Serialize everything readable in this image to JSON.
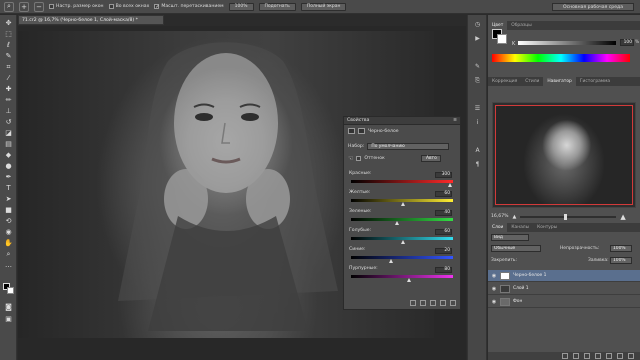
{
  "options_bar": {
    "resize_windows": "Настр. размер окон",
    "all_windows": "Во всех окнах",
    "scrubby_zoom": "Масшт. перетаскиванием",
    "zoom_100": "100%",
    "fit_screen": "Подогнать",
    "fill_screen": "Полный экран",
    "workspace": "Основная рабочая среда"
  },
  "document": {
    "tab_title": "71.cr2 @ 16,7% (Черно-белое 1, Слой-маска/8) *"
  },
  "properties": {
    "title": "Свойства",
    "adjustment_name": "Черно-белое",
    "preset_label": "Набор:",
    "preset_value": "По умолчанию",
    "tint_label": "Оттенок",
    "auto_label": "Авто",
    "sliders": [
      {
        "label": "Красные:",
        "value": "300",
        "percent": 0.99,
        "gradient": "linear-gradient(90deg,#000,#ff2a2a)"
      },
      {
        "label": "Желтые:",
        "value": "60",
        "percent": 0.52,
        "gradient": "linear-gradient(90deg,#000,#ffee33)"
      },
      {
        "label": "Зеленые:",
        "value": "40",
        "percent": 0.46,
        "gradient": "linear-gradient(90deg,#000,#33dd44)"
      },
      {
        "label": "Голубые:",
        "value": "60",
        "percent": 0.52,
        "gradient": "linear-gradient(90deg,#000,#33ddee)"
      },
      {
        "label": "Синие:",
        "value": "20",
        "percent": 0.4,
        "gradient": "linear-gradient(90deg,#000,#3355ff)"
      },
      {
        "label": "Пурпурные:",
        "value": "80",
        "percent": 0.58,
        "gradient": "linear-gradient(90deg,#000,#ee33ee)"
      }
    ]
  },
  "color_panel": {
    "tab_color": "Цвет",
    "tab_swatches": "Образцы",
    "k_label": "K",
    "k_value": "100",
    "k_unit": "%"
  },
  "navigator_panel": {
    "tab_correction": "Коррекция",
    "tab_styles": "Стили",
    "tab_navigator": "Навигатор",
    "tab_histogram": "Гистограмма",
    "zoom_value": "16,67%",
    "view_border_color": "#d23a3a"
  },
  "layers_panel": {
    "tab_layers": "Слои",
    "tab_channels": "Каналы",
    "tab_paths": "Контуры",
    "kind_filter": "Вид",
    "blend_mode": "Обычные",
    "opacity_label": "Непрозрачность:",
    "opacity_value": "100%",
    "lock_label": "Закрепить:",
    "fill_label": "Заливка:",
    "fill_value": "100%",
    "layers": [
      {
        "name": "Черно-белое 1",
        "active": true
      },
      {
        "name": "Слой 1",
        "active": false
      },
      {
        "name": "Фон",
        "active": false
      }
    ]
  },
  "icons": {
    "zoom_tool": "magnifier-icon",
    "eye": "eye-icon"
  }
}
